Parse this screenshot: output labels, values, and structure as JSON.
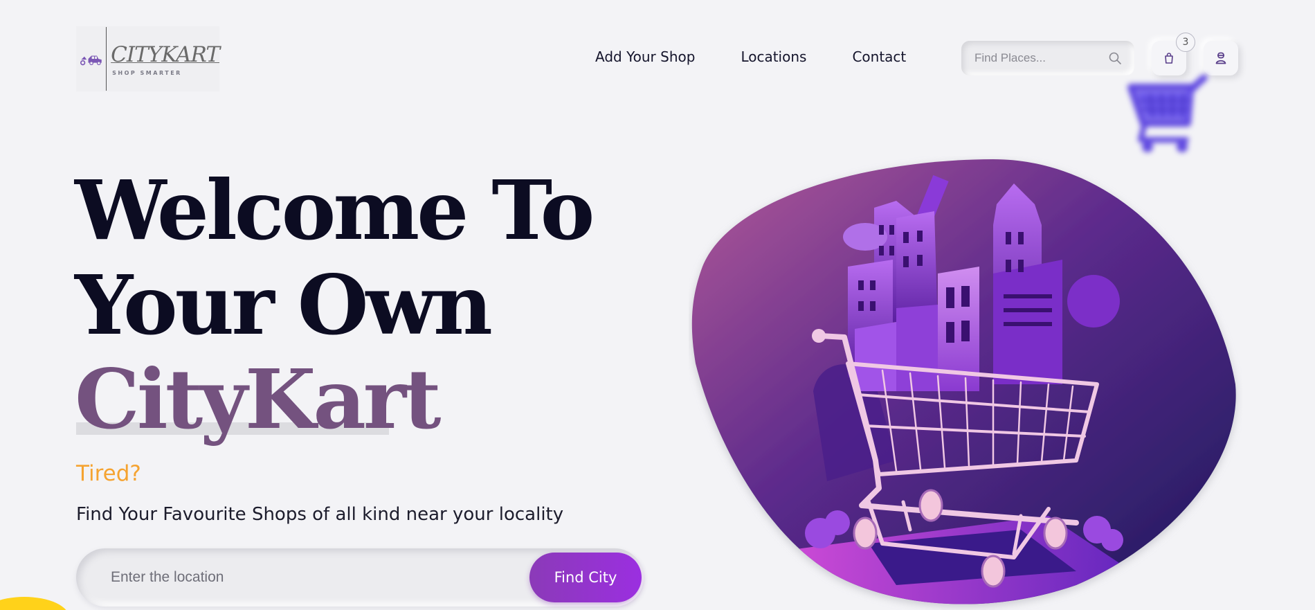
{
  "header": {
    "logo": {
      "title": "CITYKART",
      "tagline": "SHOP SMARTER"
    },
    "nav": [
      {
        "label": "Add Your Shop"
      },
      {
        "label": "Locations"
      },
      {
        "label": "Contact"
      }
    ],
    "search": {
      "placeholder": "Find Places...",
      "value": ""
    },
    "cart_count": "3"
  },
  "hero": {
    "line1": "Welcome To",
    "line2": "Your Own",
    "line3": "CityKart",
    "tired": "Tired?",
    "subtitle": "Find Your Favourite Shops of all kind near your locality",
    "location_input": {
      "placeholder": "Enter the location",
      "value": ""
    },
    "find_button": "Find City"
  },
  "icons": [
    "scooter-car-logo-icon",
    "search-icon",
    "shopping-bag-icon",
    "user-icon",
    "shopping-cart-icon"
  ],
  "colors": {
    "background": "#f3f3f6",
    "heading": "#0c0c22",
    "brand_purple": "#74527f",
    "accent_orange": "#f5a331",
    "button_purple": "#9b2fe0"
  }
}
